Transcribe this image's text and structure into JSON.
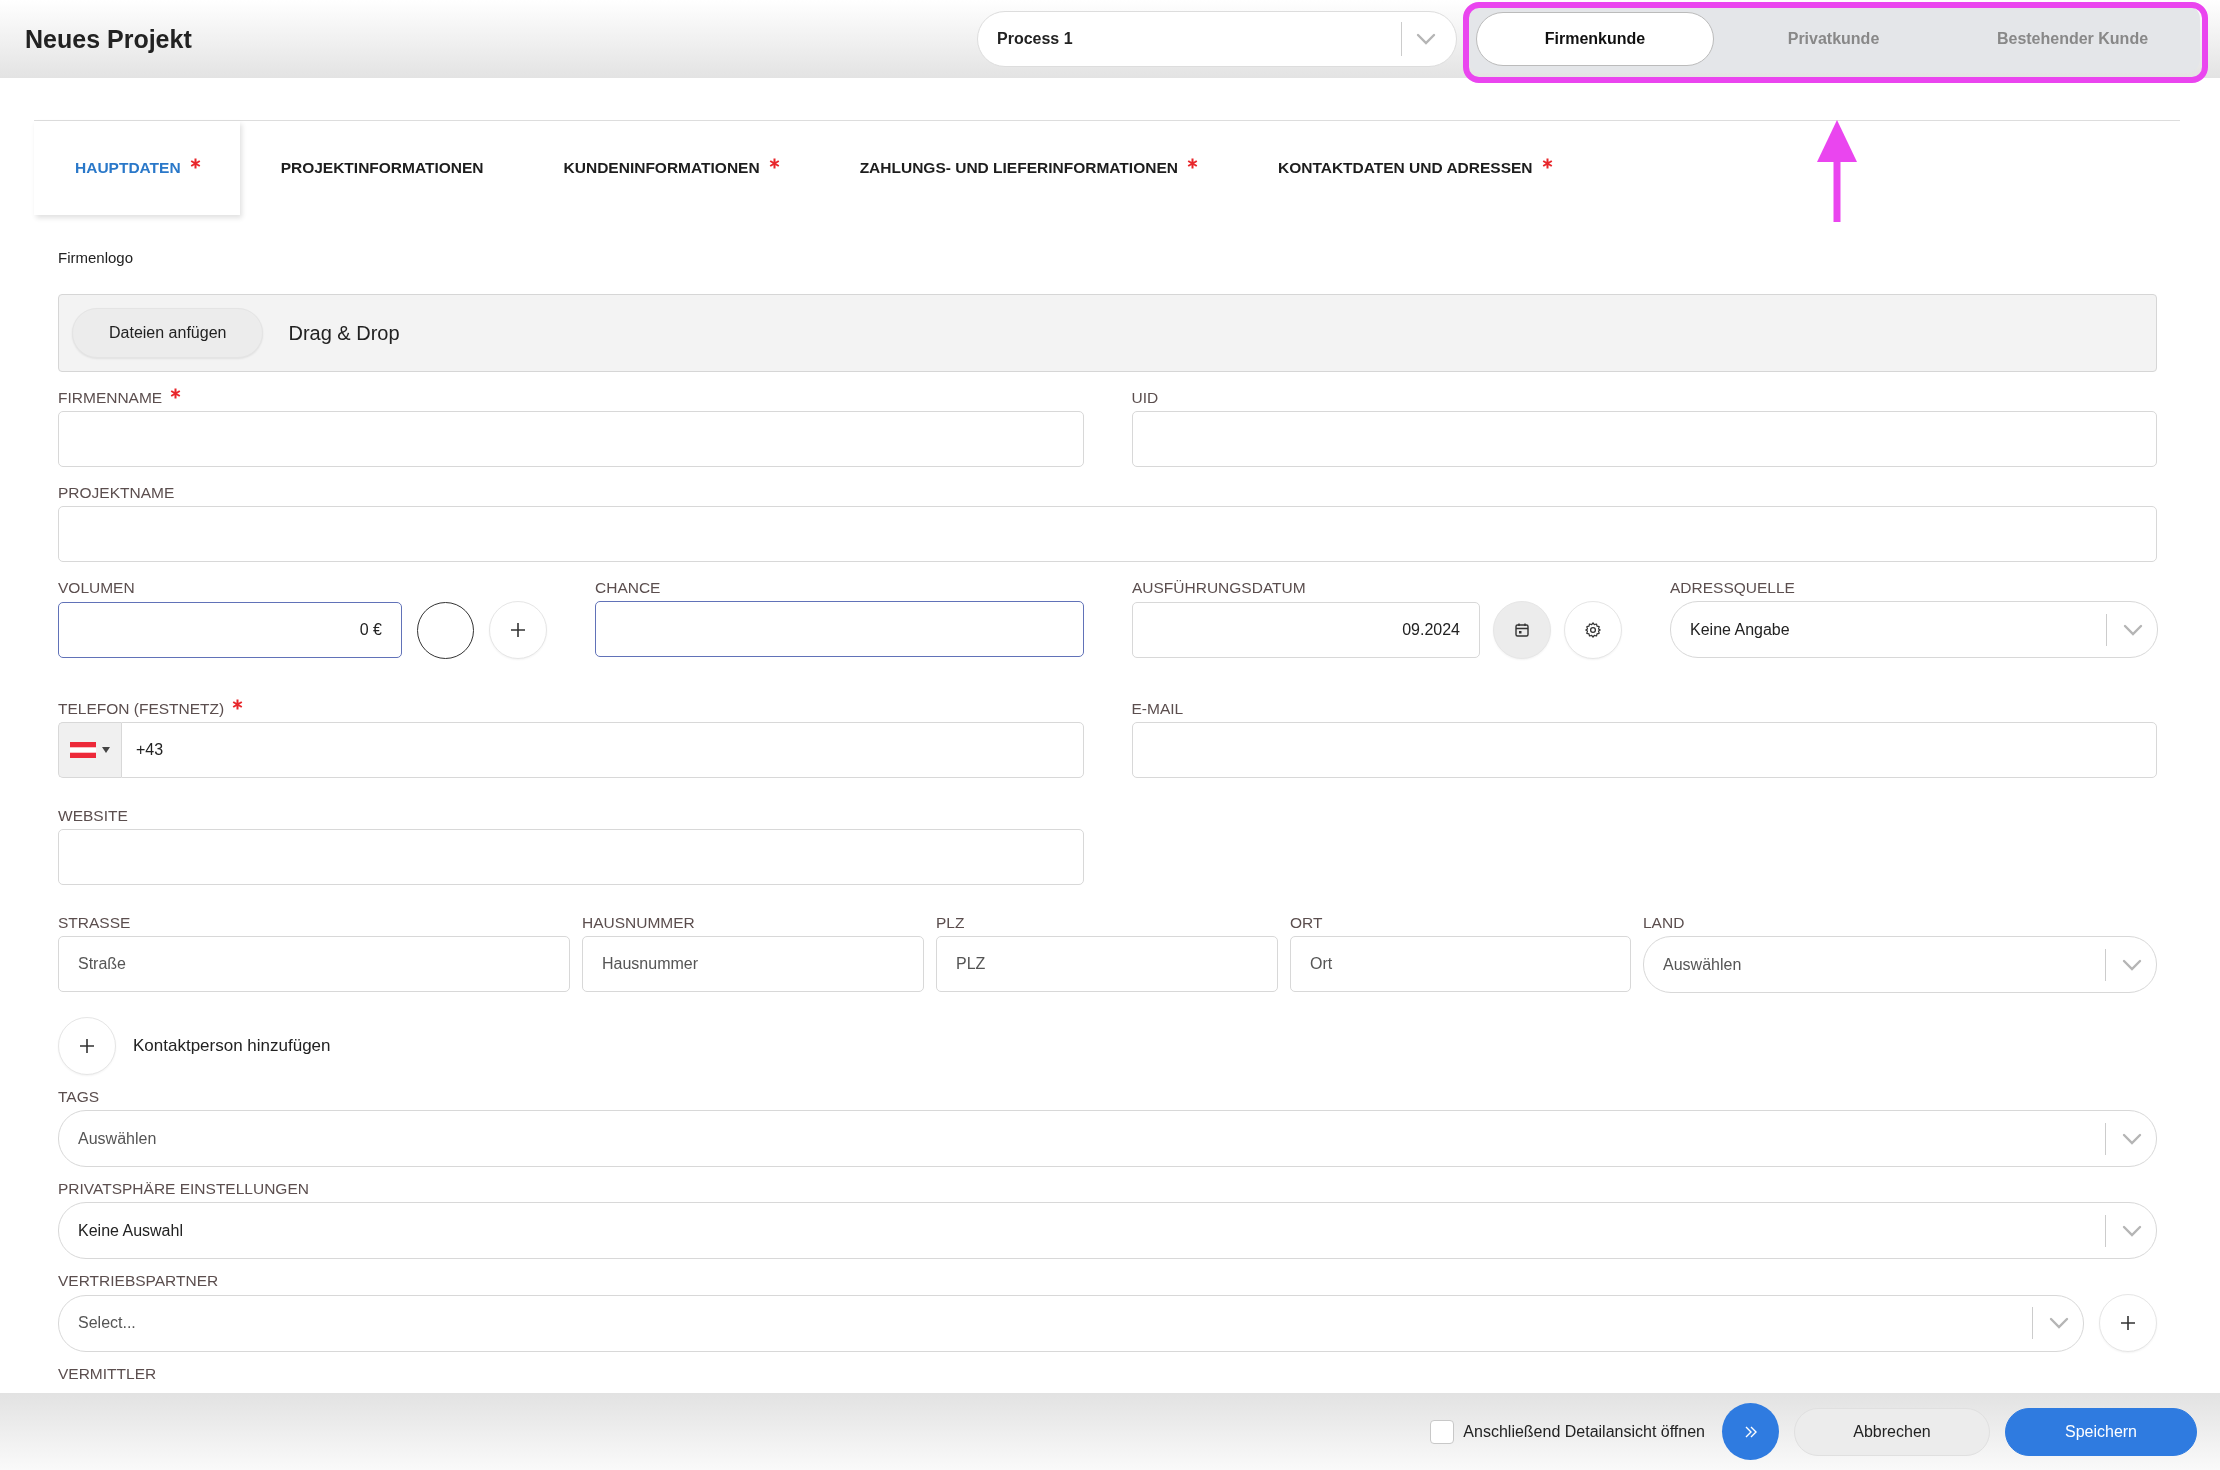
{
  "window": {
    "title": "Neues Projekt"
  },
  "process_select": {
    "value": "Process 1"
  },
  "customer_types": [
    {
      "label": "Firmenkunde",
      "selected": true
    },
    {
      "label": "Privatkunde",
      "selected": false
    },
    {
      "label": "Bestehender Kunde",
      "selected": false
    }
  ],
  "annotation": {
    "highlighted": true
  },
  "tabs": [
    {
      "label": "HAUPTDATEN",
      "required": true,
      "selected": true
    },
    {
      "label": "PROJEKTINFORMATIONEN",
      "required": false,
      "selected": false
    },
    {
      "label": "KUNDENINFORMATIONEN",
      "required": true,
      "selected": false
    },
    {
      "label": "ZAHLUNGS- UND LIEFERINFORMATIONEN",
      "required": true,
      "selected": false
    },
    {
      "label": "KONTAKTDATEN UND ADRESSEN",
      "required": true,
      "selected": false
    }
  ],
  "logo_upload": {
    "label": "Firmenlogo",
    "button": "Dateien anfügen",
    "hint": "Drag & Drop"
  },
  "rows": [
    {
      "kind": "pair",
      "fields": [
        {
          "kind": "text",
          "label": "FIRMENNAME",
          "required": true,
          "highlighted": false
        },
        {
          "kind": "text",
          "label": "UID",
          "required": false,
          "highlighted": false
        }
      ]
    },
    {
      "kind": "full",
      "fields": [
        {
          "kind": "text",
          "label": "PROJEKTNAME",
          "required": false,
          "highlighted": false
        }
      ]
    },
    {
      "kind": "quad",
      "fields": [
        {
          "kind": "money",
          "label": "VOLUMEN",
          "required": false,
          "value": "0 €",
          "highlighted": true
        },
        {
          "kind": "text",
          "label": "CHANCE",
          "required": false,
          "highlighted": true
        },
        {
          "kind": "date",
          "label": "AUSFÜHRUNGSDATUM",
          "required": false,
          "value": "09.2024",
          "highlighted": false
        },
        {
          "kind": "select",
          "label": "ADRESSQUELLE",
          "required": false,
          "value": "Keine Angabe"
        }
      ]
    },
    {
      "kind": "pair",
      "fields": [
        {
          "kind": "phone",
          "label": "TELEFON (FESTNETZ)",
          "required": true,
          "value": "+43",
          "highlighted": false
        },
        {
          "kind": "text",
          "label": "E-MAIL",
          "required": false,
          "highlighted": false
        }
      ]
    },
    {
      "kind": "half",
      "fields": [
        {
          "kind": "text",
          "label": "WEBSITE",
          "required": false,
          "highlighted": false
        }
      ]
    },
    {
      "kind": "address",
      "fields": [
        {
          "kind": "text",
          "label": "STRASSE",
          "required": false,
          "placeholder": "Straße",
          "highlighted": false
        },
        {
          "kind": "text",
          "label": "HAUSNUMMER",
          "required": false,
          "placeholder": "Hausnummer",
          "highlighted": false
        },
        {
          "kind": "text",
          "label": "PLZ",
          "required": false,
          "placeholder": "PLZ",
          "highlighted": false
        },
        {
          "kind": "text",
          "label": "ORT",
          "required": false,
          "placeholder": "Ort",
          "highlighted": false
        },
        {
          "kind": "select",
          "label": "LAND",
          "required": false,
          "placeholder": "Auswählen"
        }
      ]
    },
    {
      "kind": "contact",
      "fields": [
        {
          "kind": "add",
          "label": "Kontaktperson hinzufügen"
        }
      ]
    },
    {
      "kind": "full",
      "fields": [
        {
          "kind": "select",
          "label": "TAGS",
          "required": false,
          "placeholder": "Auswählen"
        }
      ]
    },
    {
      "kind": "full",
      "fields": [
        {
          "kind": "select",
          "label": "PRIVATSPHÄRE EINSTELLUNGEN",
          "required": false,
          "value": "Keine Auswahl"
        }
      ]
    },
    {
      "kind": "full",
      "fields": [
        {
          "kind": "select_add",
          "label": "VERTRIEBSPARTNER",
          "required": false,
          "placeholder": "Select..."
        }
      ]
    },
    {
      "kind": "full",
      "fields": [
        {
          "kind": "label_only",
          "label": "VERMITTLER",
          "required": false
        }
      ]
    }
  ],
  "footer": {
    "open_details": {
      "label": "Anschließend Detailansicht öffnen",
      "checked": false
    },
    "cancel": "Abbrechen",
    "save": "Speichern"
  }
}
